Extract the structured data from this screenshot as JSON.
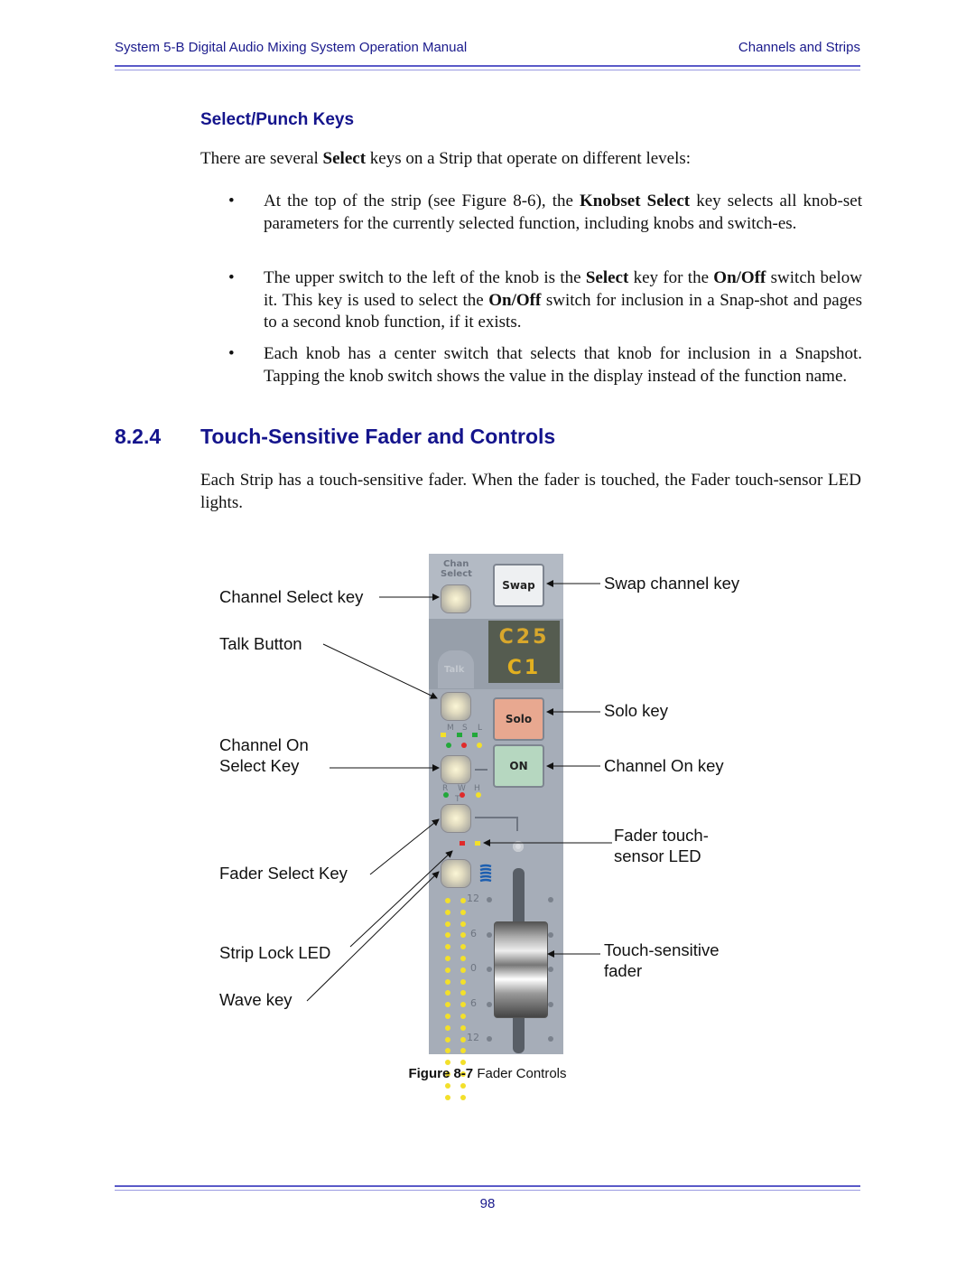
{
  "header": {
    "manual_title": "System 5-B Digital Audio Mixing System Operation Manual",
    "chapter": "Channels and Strips"
  },
  "subsection": {
    "title": "Select/Punch Keys",
    "intro_pre": "There are several ",
    "intro_bold": "Select",
    "intro_post": " keys on a Strip that operate on different levels:",
    "bullets": [
      {
        "parts": [
          {
            "t": "At the top of the strip (see Figure 8-6), the ",
            "b": false
          },
          {
            "t": "Knobset Select",
            "b": true
          },
          {
            "t": " key selects all knob-set parameters for the currently selected function, including knobs and switch-es.",
            "b": false
          }
        ]
      },
      {
        "parts": [
          {
            "t": "The upper switch to the left of the knob is the ",
            "b": false
          },
          {
            "t": "Select",
            "b": true
          },
          {
            "t": " key for the ",
            "b": false
          },
          {
            "t": "On/Off",
            "b": true
          },
          {
            "t": " switch below it. This key is used to select the ",
            "b": false
          },
          {
            "t": "On/Off",
            "b": true
          },
          {
            "t": " switch for inclusion in a Snap-shot and pages to a second knob function, if it exists.",
            "b": false
          }
        ]
      },
      {
        "parts": [
          {
            "t": "Each knob has a center switch that selects that knob for inclusion in a Snapshot. Tapping the knob switch shows the value in the display instead of the function name.",
            "b": false
          }
        ]
      }
    ]
  },
  "section": {
    "number": "8.2.4",
    "title": "Touch-Sensitive Fader and Controls",
    "body": "Each Strip has a touch-sensitive fader. When the fader is touched, the Fader touch-sensor LED lights."
  },
  "figure": {
    "caption_label": "Figure 8-7",
    "caption_text": "Fader Controls",
    "left_labels": {
      "channel_select": "Channel Select key",
      "talk": "Talk Button",
      "channel_on_1": "Channel On",
      "channel_on_2": "Select Key",
      "fader_select": "Fader Select Key",
      "strip_lock": "Strip Lock LED",
      "wave": "Wave key"
    },
    "right_labels": {
      "swap": "Swap channel key",
      "solo": "Solo key",
      "channel_on": "Channel On key",
      "touch_led_1": "Fader touch-",
      "touch_led_2": "sensor LED",
      "fader_1": "Touch-sensitive",
      "fader_2": "fader"
    },
    "strip": {
      "chan_label_1": "Chan",
      "chan_label_2": "Select",
      "swap_btn": "Swap",
      "display_line1": "C25",
      "display_line2": "C1",
      "talk_tab": "Talk",
      "solo_btn": "Solo",
      "on_btn": "ON",
      "msl": [
        "M",
        "S",
        "L"
      ],
      "rwh": [
        "R",
        "W",
        "H"
      ],
      "t_label": "T",
      "scale": [
        "12",
        "6",
        "0",
        "6",
        "12"
      ],
      "colors": {
        "display_text": "#d8a72c",
        "solo": "#e8a890",
        "on": "#b6d7c0",
        "led_green": "#22a83a",
        "led_red": "#e02a2a",
        "led_yellow": "#f3e02a"
      }
    }
  },
  "footer": {
    "page_number": "98"
  }
}
